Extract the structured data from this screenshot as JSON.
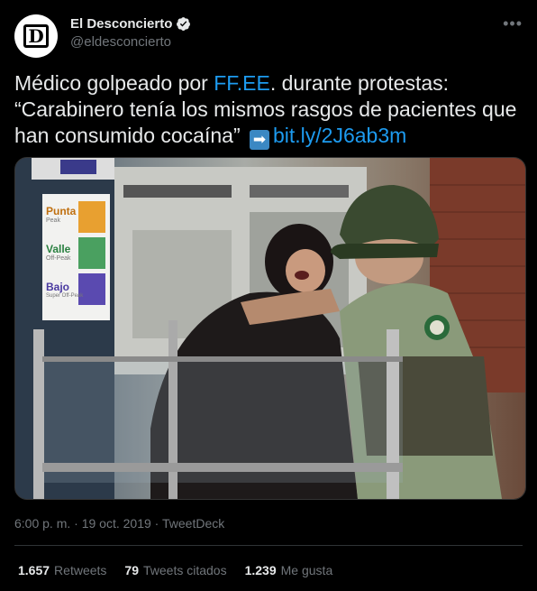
{
  "author": {
    "display_name": "El Desconcierto",
    "handle": "@eldesconcierto",
    "avatar_letter": "D",
    "verified_icon": "verified-badge-icon"
  },
  "tweet": {
    "part1": "Médico golpeado por ",
    "mention": "FF.EE",
    "part2": ". durante protestas: “Carabinero tenía los mismos rasgos de pacientes que han consumido cocaína” ",
    "emoji": "➡",
    "url": "bit.ly/2J6ab3m"
  },
  "media": {
    "signs": {
      "punta": "Punta",
      "punta_sub": "Peak",
      "valle": "Valle",
      "valle_sub": "Off-Peak",
      "bajo": "Bajo",
      "bajo_sub": "Super Off-Peak"
    }
  },
  "meta": {
    "time": "6:00 p. m.",
    "separator": "·",
    "date": "19 oct. 2019",
    "source": "TweetDeck"
  },
  "stats": {
    "retweets_count": "1.657",
    "retweets_label": "Retweets",
    "quotes_count": "79",
    "quotes_label": "Tweets citados",
    "likes_count": "1.239",
    "likes_label": "Me gusta"
  },
  "colors": {
    "link": "#1d9bf0",
    "background": "#000000",
    "secondary_text": "#71767b"
  }
}
